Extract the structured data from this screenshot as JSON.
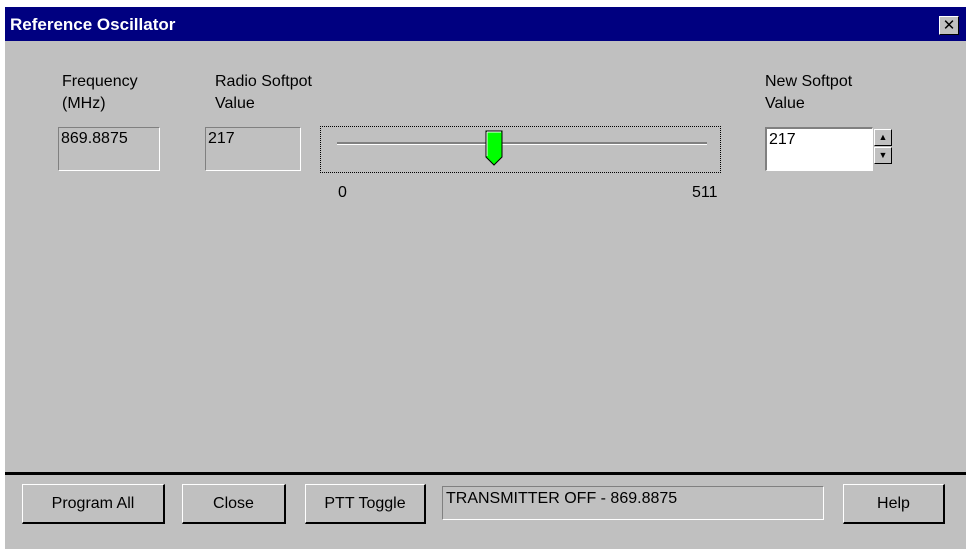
{
  "window": {
    "title": "Reference Oscillator",
    "close_glyph": "✕"
  },
  "frequency": {
    "label_line1": "Frequency",
    "label_line2": "(MHz)",
    "value": "869.8875"
  },
  "radio_softpot": {
    "label_line1": "Radio Softpot",
    "label_line2": "Value",
    "value": "217"
  },
  "slider": {
    "min_label": "0",
    "max_label": "511",
    "min": 0,
    "max": 511,
    "value": 217,
    "thumb_color": "#00ff00"
  },
  "new_softpot": {
    "label_line1": "New Softpot",
    "label_line2": "Value",
    "value": "217",
    "spin_up_glyph": "▲",
    "spin_down_glyph": "▼"
  },
  "buttons": {
    "program_all": "Program All",
    "close": "Close",
    "ptt_toggle": "PTT Toggle",
    "help": "Help"
  },
  "status": {
    "text": "TRANSMITTER OFF - 869.8875"
  },
  "colors": {
    "titlebar": "#000080",
    "face": "#c0c0c0"
  }
}
